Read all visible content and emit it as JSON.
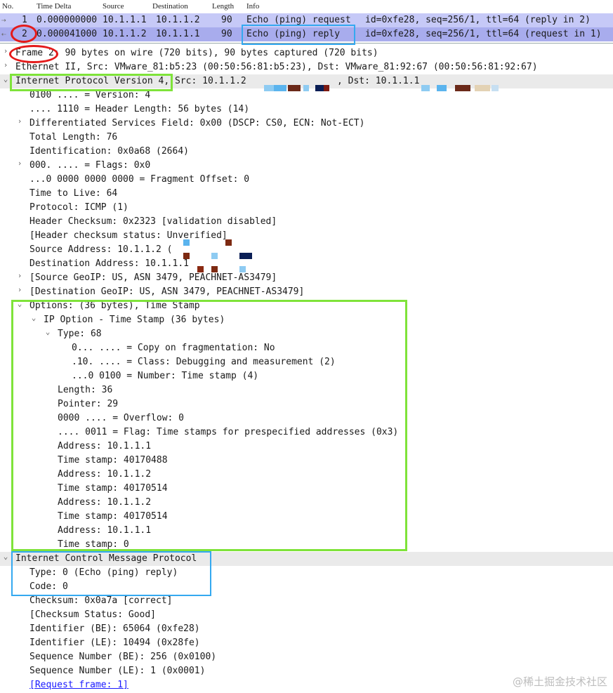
{
  "packet_list": {
    "columns": [
      "No.",
      "Time Delta",
      "Source",
      "Destination",
      "Length",
      "Info"
    ],
    "rows": [
      {
        "no": "1",
        "time": "0.000000000",
        "src": "10.1.1.1",
        "dst": "10.1.1.2",
        "len": "90",
        "info_a": "Echo (ping) request",
        "info_b": "id=0xfe28, seq=256/1, ttl=64 (reply in 2)"
      },
      {
        "no": "2",
        "time": "0.000041000",
        "src": "10.1.1.2",
        "dst": "10.1.1.1",
        "len": "90",
        "info_a": "Echo (ping) reply",
        "info_b": "id=0xfe28, seq=256/1, ttl=64 (request in 1)"
      }
    ]
  },
  "details": {
    "frame": {
      "label": "Frame 2",
      "rest": ": 90 bytes on wire (720 bits), 90 bytes captured (720 bits)"
    },
    "ethernet": "Ethernet II, Src: VMware_81:b5:23 (00:50:56:81:b5:23), Dst: VMware_81:92:67 (00:50:56:81:92:67)",
    "ip": {
      "label": "Internet Protocol Version 4",
      "src": ", Src: 10.1.1.2",
      "dst": ", Dst: 10.1.1.1",
      "lines": [
        "0100 .... = Version: 4",
        ".... 1110 = Header Length: 56 bytes (14)",
        "Differentiated Services Field: 0x00 (DSCP: CS0, ECN: Not-ECT)",
        "Total Length: 76",
        "Identification: 0x0a68 (2664)",
        "000. .... = Flags: 0x0",
        "...0 0000 0000 0000 = Fragment Offset: 0",
        "Time to Live: 64",
        "Protocol: ICMP (1)",
        "Header Checksum: 0x2323 [validation disabled]",
        "[Header checksum status: Unverified]",
        "Source Address: 10.1.1.2 (",
        "Destination Address: 10.1.1.1",
        "[Source GeoIP: US, ASN 3479, PEACHNET-AS3479]",
        "[Destination GeoIP: US, ASN 3479, PEACHNET-AS3479]"
      ],
      "options": {
        "label": "Options: (36 bytes), Time Stamp",
        "ip_option": "IP Option - Time Stamp (36 bytes)",
        "type": "Type: 68",
        "type_bits": [
          "0... .... = Copy on fragmentation: No",
          ".10. .... = Class: Debugging and measurement (2)",
          "...0 0100 = Number: Time stamp (4)"
        ],
        "fields": [
          "Length: 36",
          "Pointer: 29",
          "0000 .... = Overflow: 0",
          ".... 0011 = Flag: Time stamps for prespecified addresses (0x3)",
          "Address: 10.1.1.1",
          "Time stamp: 40170488",
          "Address: 10.1.1.2",
          "Time stamp: 40170514",
          "Address: 10.1.1.2",
          "Time stamp: 40170514",
          "Address: 10.1.1.1",
          "Time stamp: 0"
        ]
      }
    },
    "icmp": {
      "label": "Internet Control Message Protocol",
      "lines": [
        "Type: 0 (Echo (ping) reply)",
        "Code: 0",
        "Checksum: 0x0a7a [correct]",
        "[Checksum Status: Good]",
        "Identifier (BE): 65064 (0xfe28)",
        "Identifier (LE): 10494 (0x28fe)",
        "Sequence Number (BE): 256 (0x0100)",
        "Sequence Number (LE): 1 (0x0001)"
      ],
      "link": "[Request frame: 1]"
    }
  },
  "watermark": "@稀土掘金技术社区",
  "colors": {
    "row1": "#c6c9f7",
    "row2": "#a8aced",
    "green_box": "#7fe33a",
    "blue_box": "#34a9f0",
    "red_ellipse": "#e41a1a"
  }
}
